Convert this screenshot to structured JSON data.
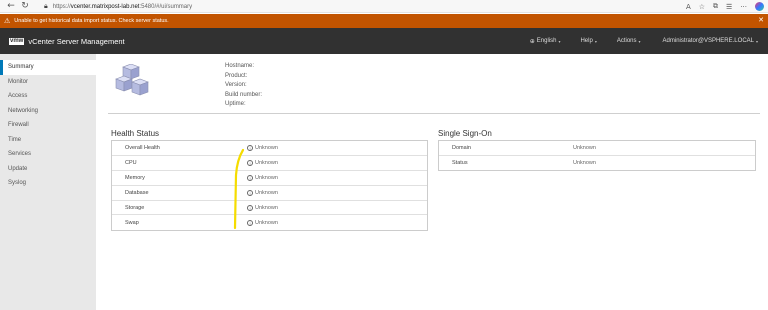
{
  "browser": {
    "url_scheme": "https://",
    "url_host": "vcenter.matrixpost-lab.net",
    "url_rest": ":5480/#/ui/summary"
  },
  "alert": {
    "text": "Unable to get historical data import status. Check server status."
  },
  "header": {
    "logo": "vmw",
    "title": "vCenter Server Management",
    "language": "English",
    "help": "Help",
    "actions": "Actions",
    "user": "Administrator@VSPHERE.LOCAL"
  },
  "sidebar": {
    "items": [
      {
        "label": "Summary"
      },
      {
        "label": "Monitor"
      },
      {
        "label": "Access"
      },
      {
        "label": "Networking"
      },
      {
        "label": "Firewall"
      },
      {
        "label": "Time"
      },
      {
        "label": "Services"
      },
      {
        "label": "Update"
      },
      {
        "label": "Syslog"
      }
    ]
  },
  "summary": {
    "hostname": "Hostname:",
    "product": "Product:",
    "version": "Version:",
    "build": "Build number:",
    "uptime": "Uptime:"
  },
  "health": {
    "title": "Health Status",
    "rows": [
      {
        "name": "Overall Health",
        "value": "Unknown"
      },
      {
        "name": "CPU",
        "value": "Unknown"
      },
      {
        "name": "Memory",
        "value": "Unknown"
      },
      {
        "name": "Database",
        "value": "Unknown"
      },
      {
        "name": "Storage",
        "value": "Unknown"
      },
      {
        "name": "Swap",
        "value": "Unknown"
      }
    ]
  },
  "sso": {
    "title": "Single Sign-On",
    "rows": [
      {
        "name": "Domain",
        "value": "Unknown"
      },
      {
        "name": "Status",
        "value": "Unknown"
      }
    ]
  },
  "colors": {
    "alert": "#c25400",
    "header": "#313131",
    "sidebar": "#e8e8e8",
    "accent": "#0079b8",
    "annotation": "#f5dc00"
  }
}
